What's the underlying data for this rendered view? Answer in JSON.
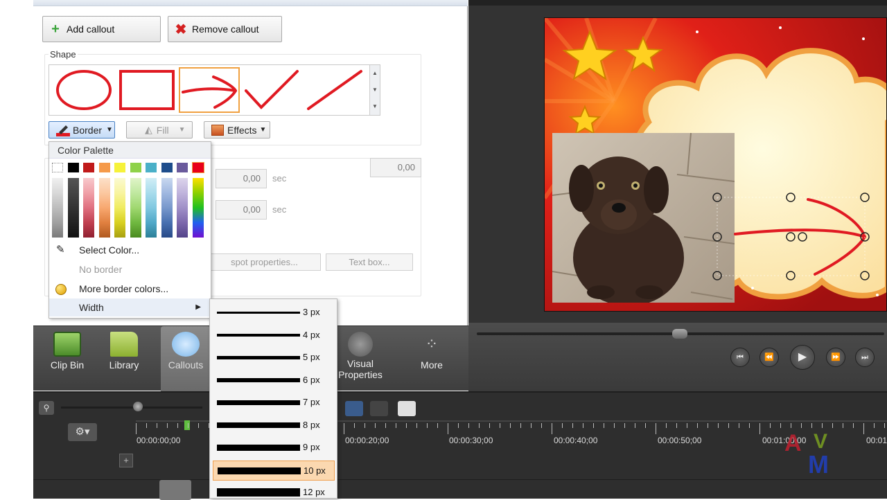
{
  "callouts": {
    "add_label": "Add callout",
    "remove_label": "Remove callout",
    "shape_label": "Shape",
    "shapes": [
      "ellipse",
      "rectangle",
      "arrow",
      "checkmark",
      "line"
    ],
    "selected_shape": "arrow",
    "border_label": "Border",
    "fill_label": "Fill",
    "effects_label": "Effects",
    "field_top_right": "0,00",
    "field_1": "0,00",
    "field_2": "0,00",
    "unit_sec": "sec",
    "hotspot_label": "spot properties...",
    "textbox_label": "Text box..."
  },
  "palette_menu": {
    "header": "Color Palette",
    "select_color": "Select Color...",
    "no_border": "No border",
    "more_colors": "More border colors...",
    "width": "Width",
    "top_colors": [
      "#000000",
      "#c01a1a",
      "#f59a4a",
      "#f6f23a",
      "#8ed24a",
      "#4ab0c8",
      "#1e4d8c",
      "#6a5a9c",
      "#e8001a"
    ]
  },
  "width_menu": {
    "items": [
      "3 px",
      "4 px",
      "5 px",
      "6 px",
      "7 px",
      "8 px",
      "9 px",
      "10 px",
      "12 px"
    ],
    "selected": "10 px"
  },
  "tools": {
    "clip_bin": "Clip Bin",
    "library": "Library",
    "callouts": "Callouts",
    "visual_properties_1": "Visual",
    "visual_properties_2": "Properties",
    "more": "More"
  },
  "timeline": {
    "timecodes": [
      "00:00:00;00",
      "00:00:20;00",
      "00:00:30;00",
      "00:00:40;00",
      "00:00:50;00",
      "00:01:00;00",
      "00:01"
    ]
  },
  "colors": {
    "accent_orange": "#f0a040",
    "callout_red": "#e01a22",
    "dark_bg": "#333333"
  }
}
